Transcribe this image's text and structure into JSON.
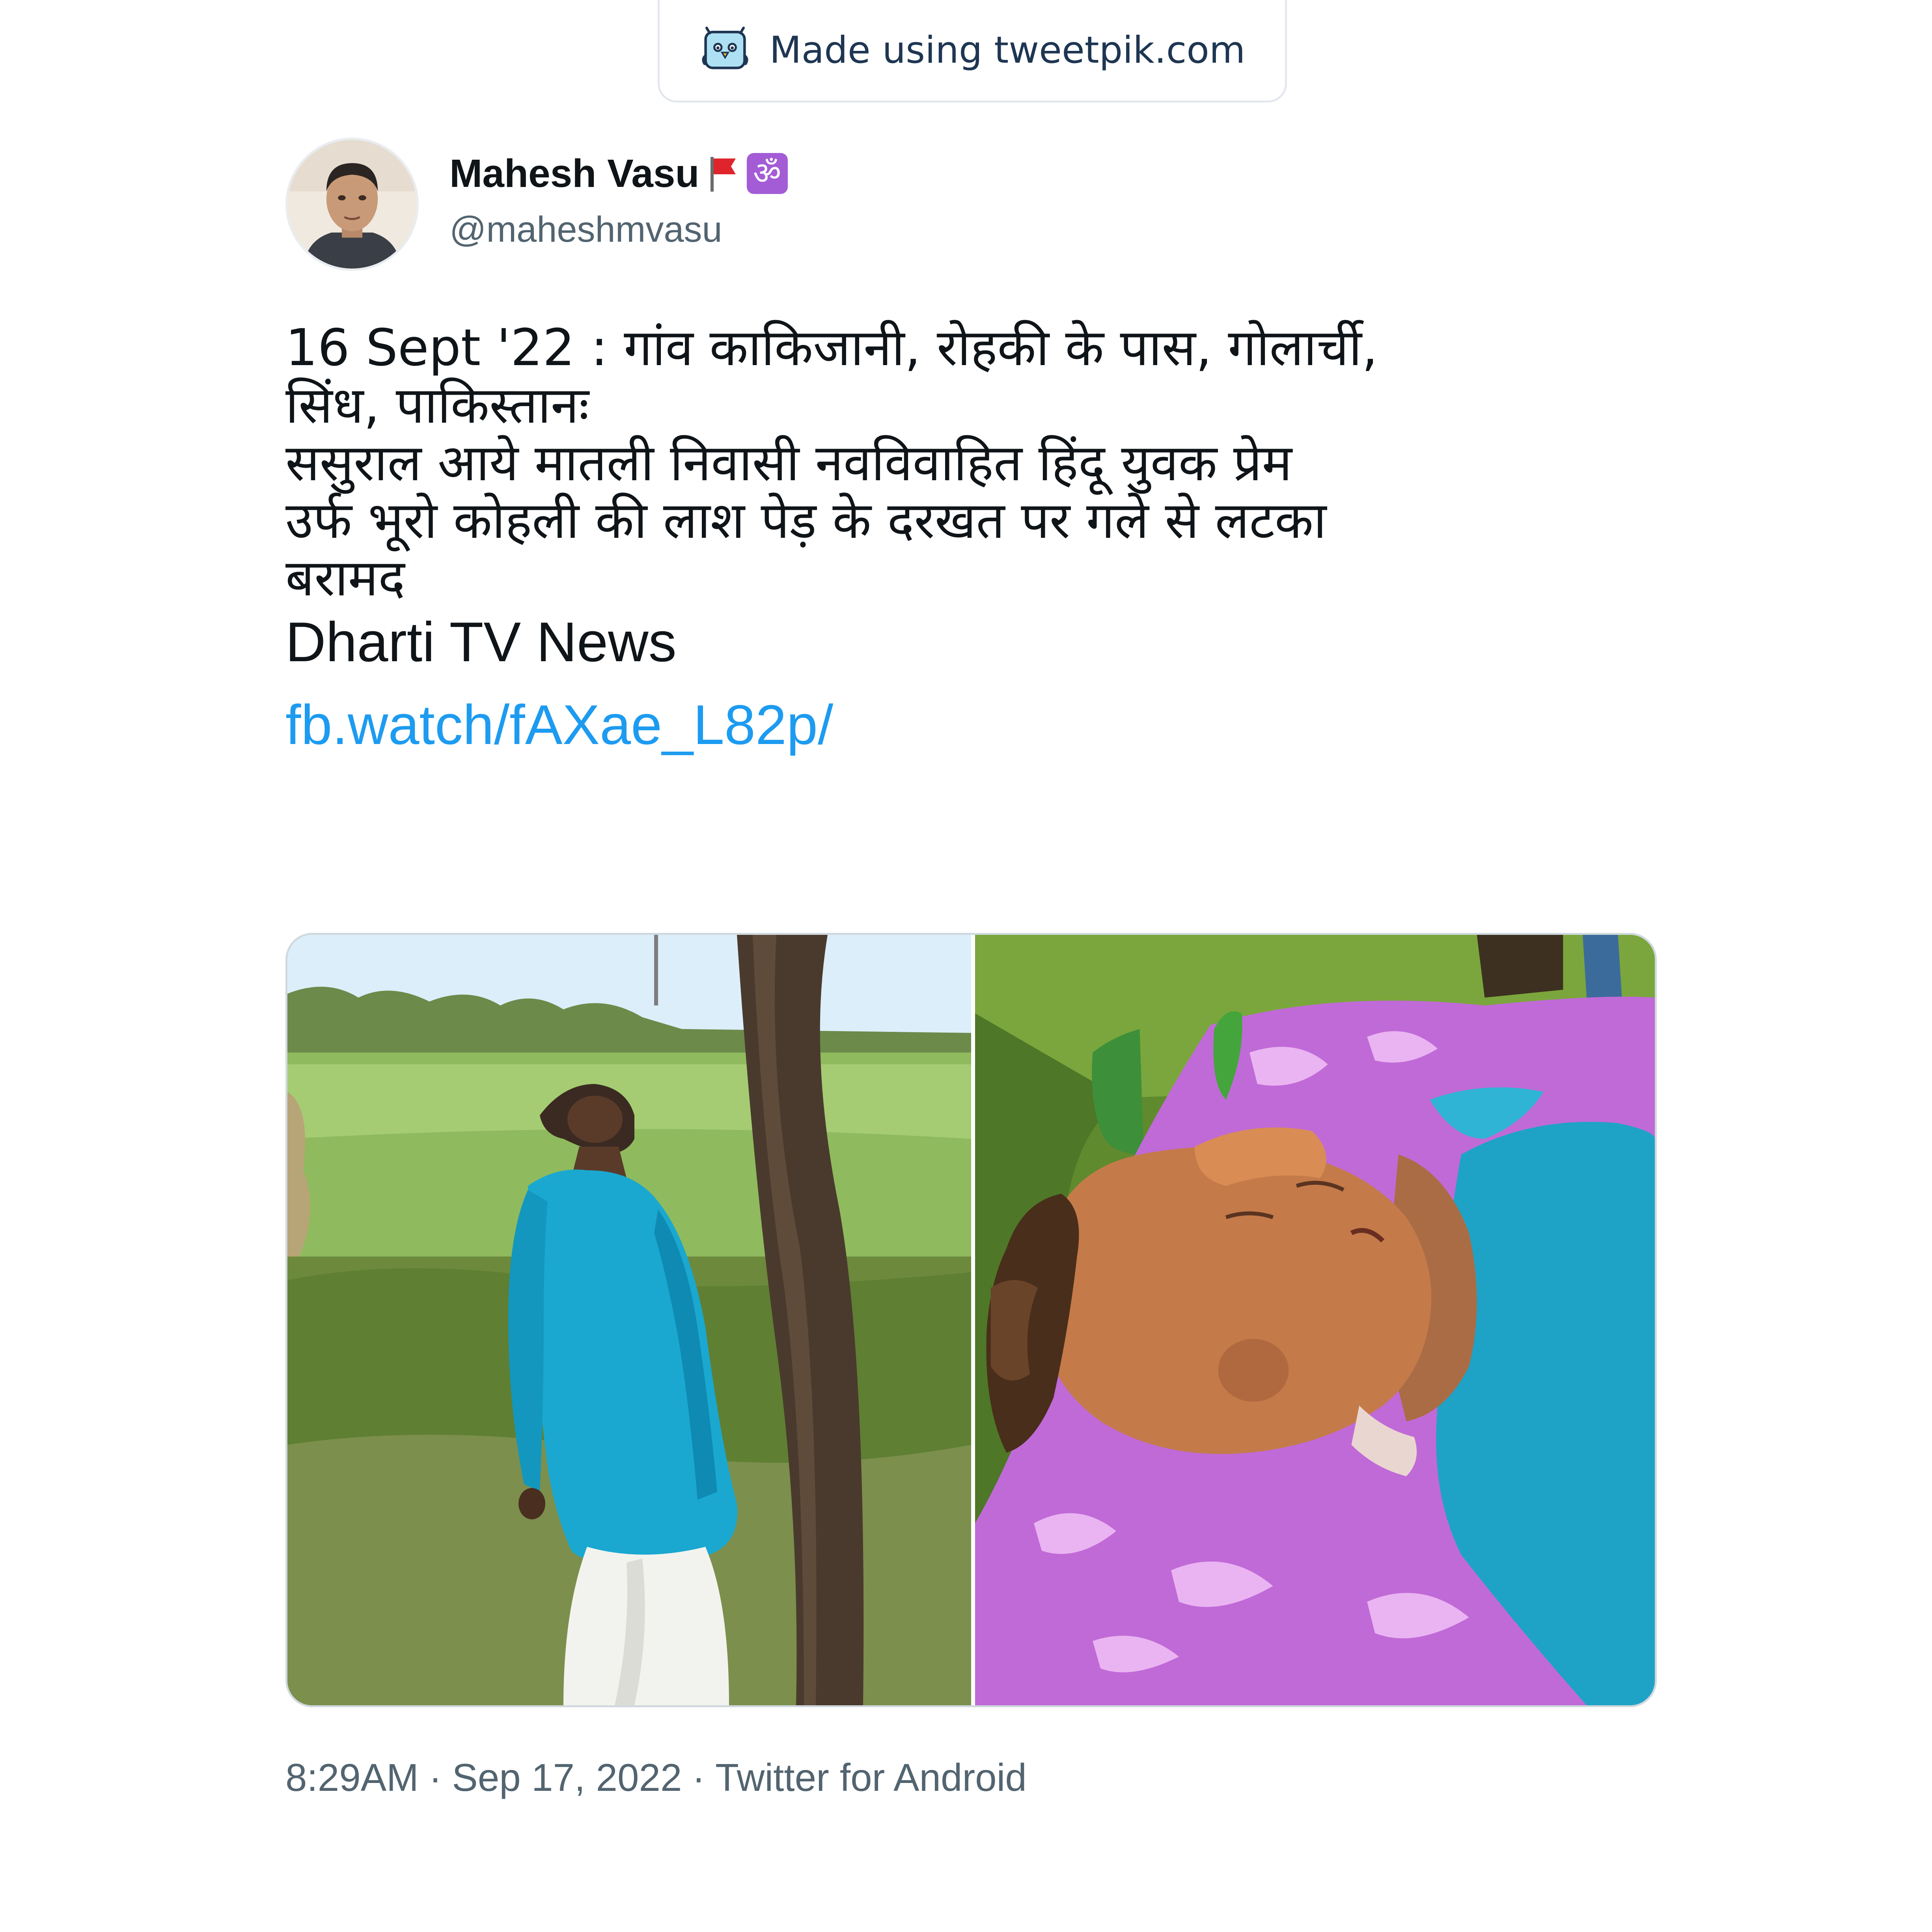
{
  "watermark": {
    "text": "Made using tweetpik.com",
    "icon": "tweetpik-bird-icon"
  },
  "author": {
    "name": "Mahesh Vasu",
    "handle": "@maheshmvasu",
    "emoji_flag": "red-flag-icon",
    "emoji_om": "ॐ",
    "avatar": "profile-photo"
  },
  "tweet": {
    "lines": [
      "16 Sept '22 : गांव काकिजानी, रोहकी के पास, गोलार्ची,",
      "सिंध, पाकिस्तानः",
      "ससुराल आये मातली निवासी नवविवाहित हिंदू युवक प्रेम",
      "उर्फ भूरो कोहली की लाश पेड़ के दरखत पर गले से लटका",
      "बरामद"
    ],
    "source": "Dharti TV News",
    "link": "fb.watch/fAXae_L82p/"
  },
  "media": [
    {
      "name": "photo-man-standing-by-tree",
      "scene": "man in blue kurta beside tree in green field"
    },
    {
      "name": "photo-man-lying-on-sheet",
      "scene": "man in blue kurta lying on pink floral sheet"
    }
  ],
  "meta": {
    "time": "8:29AM",
    "separator": "·",
    "date": "Sep 17, 2022",
    "client": "Twitter for Android"
  },
  "colors": {
    "link": "#1d9bf0",
    "secondary_text": "#536471",
    "primary_text": "#0f1419",
    "border": "#cfd9de",
    "om_badge": "#a45bd6"
  }
}
